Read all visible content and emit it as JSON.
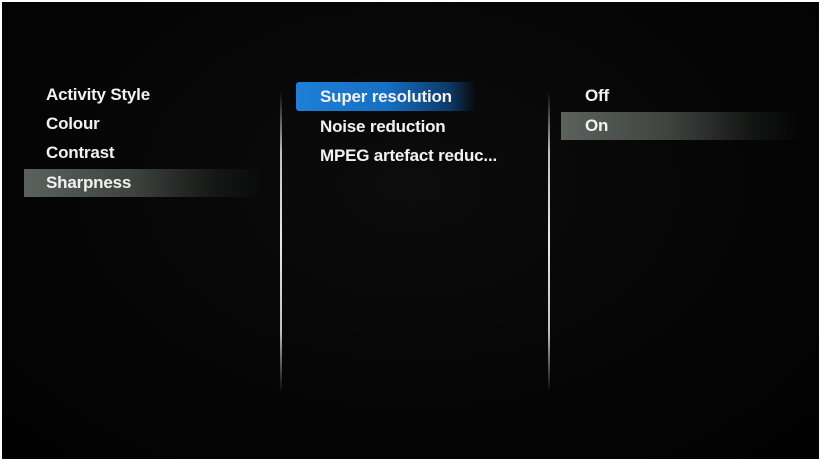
{
  "menu": {
    "left": {
      "items": [
        {
          "label": "Activity Style"
        },
        {
          "label": "Colour"
        },
        {
          "label": "Contrast"
        },
        {
          "label": "Sharpness"
        }
      ],
      "selected": "Sharpness"
    },
    "middle": {
      "items": [
        {
          "label": "Super resolution"
        },
        {
          "label": "Noise reduction"
        },
        {
          "label": "MPEG artefact reduc..."
        }
      ],
      "focused": "Super resolution"
    },
    "right": {
      "items": [
        {
          "label": "Off"
        },
        {
          "label": "On"
        }
      ],
      "selected": "On"
    }
  },
  "colors": {
    "background": "#050505",
    "focus": "#1e7fd6",
    "selection": "#4a504d",
    "text": "#f2f2f2"
  }
}
